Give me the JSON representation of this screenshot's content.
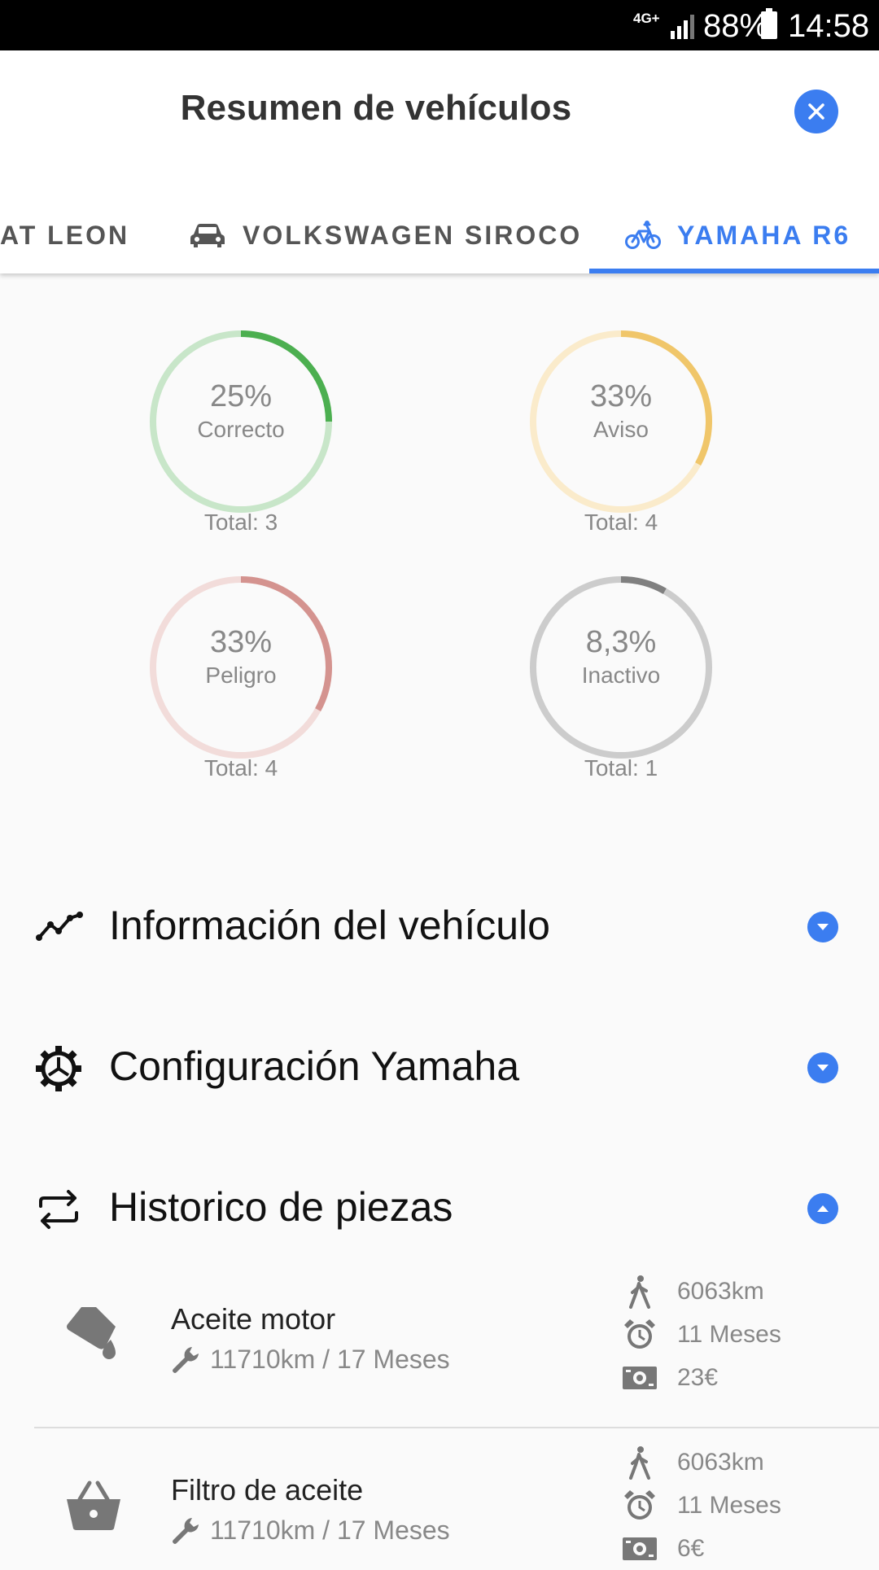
{
  "status_bar": {
    "network": "4G+",
    "battery": "88%",
    "time": "14:58"
  },
  "header": {
    "title": "Resumen de vehículos"
  },
  "tabs": [
    {
      "label": "AT LEON",
      "icon": "car-icon"
    },
    {
      "label": "VOLKSWAGEN SIROCO",
      "icon": "car-icon"
    },
    {
      "label": "YAMAHA R6",
      "icon": "bike-icon",
      "active": true
    }
  ],
  "stats": [
    {
      "percent": "25%",
      "label": "Correcto",
      "total": "Total: 3",
      "fraction": 0.25,
      "color": "#4caf50",
      "track": "#c8e6c9"
    },
    {
      "percent": "33%",
      "label": "Aviso",
      "total": "Total: 4",
      "fraction": 0.33,
      "color": "#f0c66a",
      "track": "#faebcb"
    },
    {
      "percent": "33%",
      "label": "Peligro",
      "total": "Total: 4",
      "fraction": 0.33,
      "color": "#d4938f",
      "track": "#f2dcda"
    },
    {
      "percent": "8,3%",
      "label": "Inactivo",
      "total": "Total: 1",
      "fraction": 0.083,
      "color": "#808080",
      "track": "#cccccc"
    }
  ],
  "sections": [
    {
      "title": "Información del vehículo",
      "icon": "chart-line-icon",
      "expanded": false
    },
    {
      "title": "Configuración Yamaha",
      "icon": "gear-icon",
      "expanded": false
    },
    {
      "title": "Historico de piezas",
      "icon": "swap-icon",
      "expanded": true
    }
  ],
  "parts": [
    {
      "name": "Aceite motor",
      "interval": "11710km / 17 Meses",
      "icon": "oil-can-icon",
      "km": "6063km",
      "months": "11 Meses",
      "cost": "23€"
    },
    {
      "name": "Filtro de aceite",
      "interval": "11710km / 17 Meses",
      "icon": "basket-icon",
      "km": "6063km",
      "months": "11 Meses",
      "cost": "6€"
    }
  ],
  "accent_color": "#3b7df0"
}
